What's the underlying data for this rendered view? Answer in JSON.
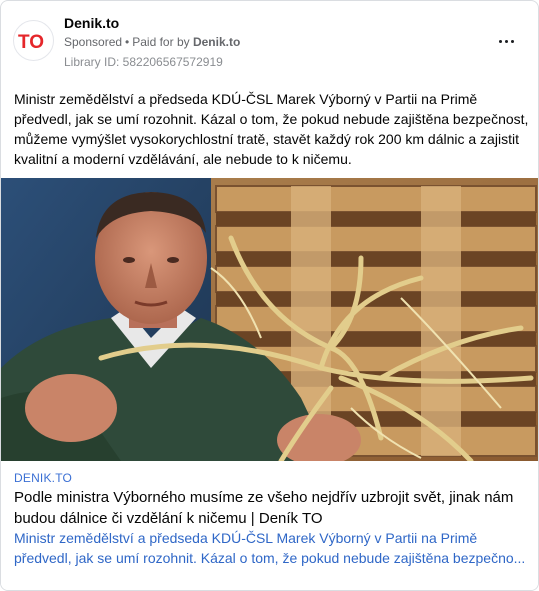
{
  "header": {
    "page_name": "Denik.to",
    "sponsored": "Sponsored",
    "separator": "•",
    "paid_for_prefix": "Paid for by",
    "paid_for_name": "Denik.to",
    "library_id": "Library ID: 582206567572919",
    "avatar_text": "TO"
  },
  "post": {
    "text": "Ministr zemědělství a předseda KDÚ-ČSL Marek Výborný v Partii na Primě předvedl, jak se umí rozohnit. Kázal o tom, že pokud nebude zajištěna bezpečnost, můžeme vymýšlet vysokorychlostní tratě, stavět každý rok 200 km dálnic a zajistit kvalitní a moderní vzdělávání, ale nebude to k ničemu."
  },
  "link": {
    "domain": "DENIK.TO",
    "headline": "Podle ministra Výborného musíme ze všeho nejdřív uzbrojit svět, jinak nám budou dálnice či vzdělání k ničemu | Deník TO",
    "description_line1": "Ministr zemědělství a předseda KDÚ-ČSL Marek Výborný v Partii na Primě",
    "description_line2": "předvedl, jak se umí rozohnit. Kázal o tom, že pokud nebude zajištěna bezpečno..."
  },
  "colors": {
    "brand_red": "#e5262a",
    "link_blue": "#2f67c7",
    "muted_gray": "#65676b"
  },
  "icons": {
    "more": "more-horizontal-icon",
    "avatar": "denik-to-logo"
  }
}
